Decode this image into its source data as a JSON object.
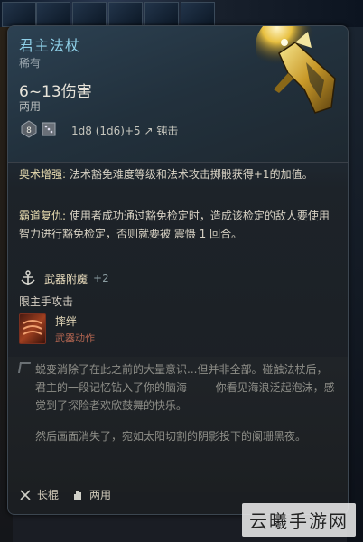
{
  "item": {
    "name": "君主法杖",
    "rarity": "稀有",
    "damage": "6~13伤害",
    "handedness": "两用",
    "dice": {
      "die_value": "8",
      "formula": "1d8 (1d6)+5",
      "damage_type": "钝击"
    }
  },
  "passives": [
    {
      "name": "奥术增强:",
      "text": "法术豁免难度等级和法术攻击掷骰获得+1的加值。"
    },
    {
      "name": "霸道复仇:",
      "text": "使用者成功通过豁免检定时，造成该检定的敌人要使用智力进行豁免检定，否则就要被 震慑 1 回合。"
    }
  ],
  "enchant": {
    "label": "武器附魔",
    "value": "+2"
  },
  "restriction": "限主手攻击",
  "action": {
    "name": "摔绊",
    "type": "武器动作"
  },
  "lore": {
    "paragraph1": "蜕变消除了在此之前的大量意识...但并非全部。碰触法杖后，君主的一段记忆钻入了你的脑海 —— 你看见海浪泛起泡沫，感觉到了探险者欢欣鼓舞的快乐。",
    "paragraph2": "然后画面消失了，宛如太阳切割的阴影投下的阑珊黑夜。"
  },
  "footer": {
    "weapon_type": "长棍",
    "hand": "两用"
  },
  "watermark": "云曦手游网",
  "colors": {
    "title": "#8fd0e8",
    "skill_type": "#b06450",
    "enchant_value": "#8a9ca0"
  }
}
